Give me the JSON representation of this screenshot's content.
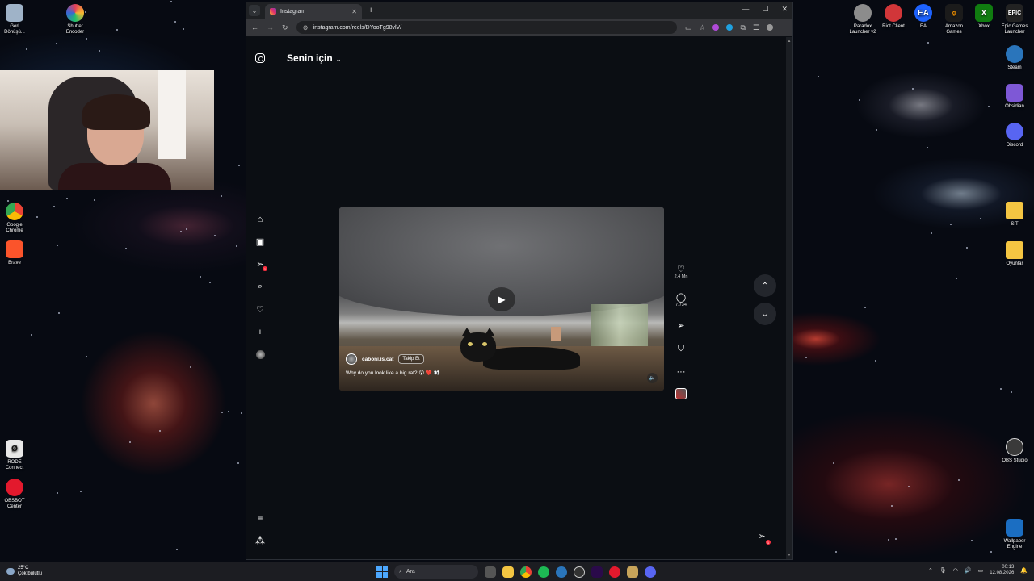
{
  "desktop": {
    "left_icons": [
      {
        "label": "Geri\nDönüşü...",
        "icon": "recycle-bin-icon",
        "color": "#9fb3c8"
      },
      {
        "label": "Shutter\nEncoder",
        "icon": "shutter-encoder-icon",
        "color": "#e2405a"
      },
      {
        "label": "Google\nChrome",
        "icon": "chrome-icon",
        "color": "#34a853"
      },
      {
        "label": "Brave",
        "icon": "brave-icon",
        "color": "#fb542b"
      },
      {
        "label": "RODE\nConnect",
        "icon": "rode-connect-icon",
        "color": "#e8e8e8"
      },
      {
        "label": "OBSBOT\nCenter",
        "icon": "obsbot-icon",
        "color": "#e3192d"
      }
    ],
    "top_right_icons": [
      {
        "label": "Paradox\nLauncher v2",
        "icon": "paradox-icon",
        "color": "#8c8c8c"
      },
      {
        "label": "Riot Client",
        "icon": "riot-icon",
        "color": "#d13639"
      },
      {
        "label": "EA",
        "icon": "ea-icon",
        "color": "#1e63ff"
      },
      {
        "label": "Amazon\nGames",
        "icon": "amazon-games-icon",
        "color": "#ff9900"
      },
      {
        "label": "Xbox",
        "icon": "xbox-icon",
        "color": "#107c10"
      },
      {
        "label": "Epic Games\nLauncher",
        "icon": "epic-games-icon",
        "color": "#222222"
      }
    ],
    "right_icons": [
      {
        "label": "Steam",
        "icon": "steam-icon",
        "color": "#2a75bb"
      },
      {
        "label": "Obsidian",
        "icon": "obsidian-icon",
        "color": "#7e58d6"
      },
      {
        "label": "Discord",
        "icon": "discord-icon",
        "color": "#5865f2"
      },
      {
        "label": "SIT",
        "icon": "folder-icon",
        "color": "#f4c542"
      },
      {
        "label": "Oyunlar",
        "icon": "folder-icon",
        "color": "#f4c542"
      },
      {
        "label": "OBS Studio",
        "icon": "obs-icon",
        "color": "#3a3a3a"
      },
      {
        "label": "Wallpaper\nEngine",
        "icon": "wallpaper-engine-icon",
        "color": "#1b6ec2"
      }
    ]
  },
  "browser": {
    "tab_title": "Instagram",
    "url": "instagram.com/reels/DYooTg98vlV/"
  },
  "instagram": {
    "feed_title": "Senin için",
    "notification_badge": "1",
    "reel": {
      "username": "caboni.is.cat",
      "follow_label": "Takip Et",
      "caption": "Why do you look like a big rat? 😮 ❤️ 👀",
      "likes": "2,4 Mn",
      "comments": "7.734"
    }
  },
  "taskbar": {
    "temperature": "25°C",
    "weather": "Çok bulutlu",
    "search_placeholder": "Ara",
    "time": "00:13",
    "date": "12.08.2026"
  }
}
